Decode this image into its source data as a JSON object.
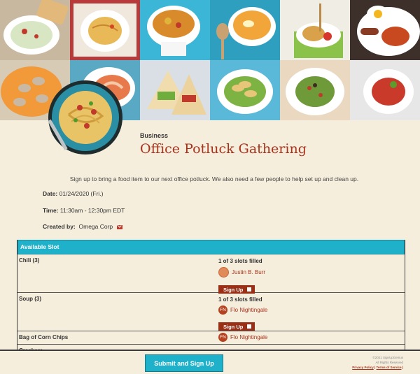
{
  "event": {
    "category": "Business",
    "title": "Office Potluck Gathering",
    "description": "Sign up to bring a food item to our next office potluck. We also need a few people to help set up and clean up."
  },
  "details": {
    "date_label": "Date:",
    "date_value": "01/24/2020 (Fri.)",
    "time_label": "Time:",
    "time_value": "11:30am - 12:30pm EDT",
    "created_label": "Created by:",
    "created_value": "Omega Corp"
  },
  "table": {
    "header": "Available Slot",
    "rows": [
      {
        "name": "Chili (3)",
        "filled": "1 of 3 slots filled",
        "person": "Justin B. Burr",
        "avatar": "",
        "button": "Sign Up"
      },
      {
        "name": "Soup (3)",
        "filled": "1 of 3 slots filled",
        "person": "Flo Nightingale",
        "avatar": "FN",
        "button": "Sign Up"
      },
      {
        "name": "Bag of Corn Chips",
        "person": "Flo Nightingale",
        "avatar": "FN"
      },
      {
        "name": "Crackers"
      }
    ]
  },
  "footer": {
    "submit": "Submit and Sign Up",
    "copyright": "©2021 SignUpGenius",
    "rights": "All Rights Reserved",
    "privacy": "Privacy Policy",
    "separator": "|",
    "terms": "Terms of Service",
    "trail": "|"
  },
  "colors": {
    "accent": "#1fb1c9",
    "title": "#a8331c",
    "button": "#9b2f16",
    "background": "#f6eedd"
  }
}
